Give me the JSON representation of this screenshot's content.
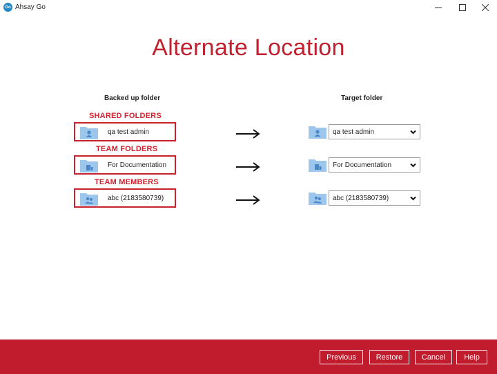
{
  "window": {
    "title": "Ahsay Go",
    "logo_text": "Go"
  },
  "page": {
    "title": "Alternate Location"
  },
  "columns": {
    "left_header": "Backed up folder",
    "right_header": "Target folder"
  },
  "rows": [
    {
      "section": "SHARED FOLDERS",
      "source": "qa test admin",
      "target": "qa test admin",
      "icon": "shared-folder-icon"
    },
    {
      "section": "TEAM FOLDERS",
      "source": "For Documentation",
      "target": "For Documentation",
      "icon": "team-folder-icon"
    },
    {
      "section": "TEAM MEMBERS",
      "source": "abc (2183580739)",
      "target": "abc (2183580739)",
      "icon": "team-member-folder-icon"
    }
  ],
  "buttons": {
    "previous": "Previous",
    "restore": "Restore",
    "cancel": "Cancel",
    "help": "Help"
  },
  "colors": {
    "accent": "#c11c2e",
    "folder": "#9cc6ec",
    "folder_glyph": "#4a86c8",
    "highlight_border": "#c8202c"
  }
}
